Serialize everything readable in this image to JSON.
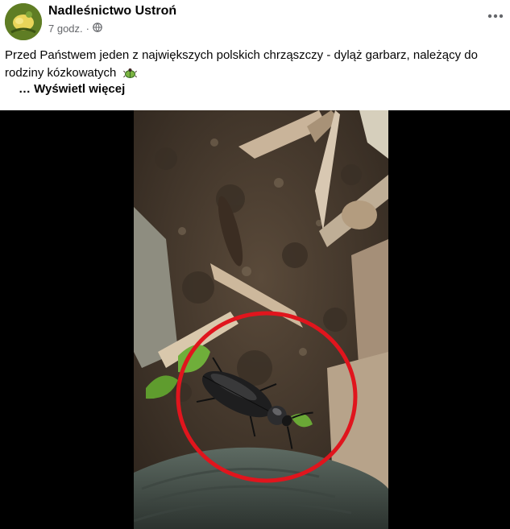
{
  "post": {
    "author": "Nadleśnictwo Ustroń",
    "time": "7 godz.",
    "separator": "·",
    "audience_icon": "globe-icon",
    "more_icon": "more-horizontal-icon",
    "text": "Przed Państwem jeden z największych polskich chrząszczy - dyląż garbarz, należący do rodziny kózkowatych",
    "see_more_prefix": "…",
    "see_more": "Wyświetl więcej"
  },
  "media": {
    "type": "video-thumbnail",
    "highlight_color": "#e0151d"
  }
}
